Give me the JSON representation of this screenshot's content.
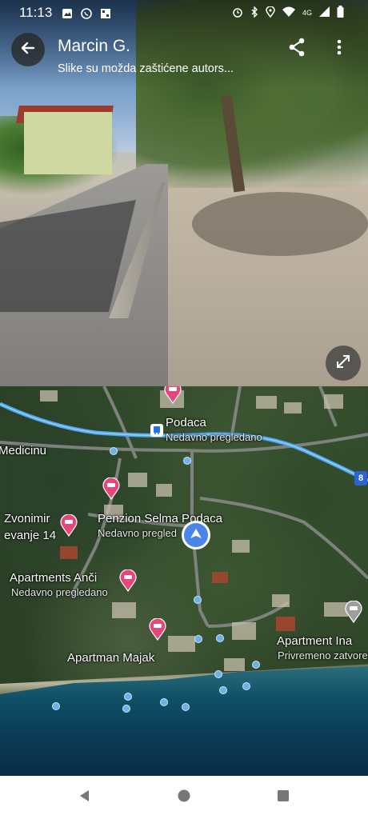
{
  "status_bar": {
    "time": "11:13",
    "network": "4G"
  },
  "header": {
    "title": "Marcin G.",
    "subtitle": "Slike su možda zaštićene autors..."
  },
  "map": {
    "labels": {
      "place_podaca": "Podaca",
      "place_podaca_sub": "Nedavno pregledano",
      "medicinu": "Medicinu",
      "zvonimir": "Zvonimir",
      "zvonimir_sub": "evanje 14",
      "penzion": "Penzion Selma Podaca",
      "penzion_sub": "Nedavno pregled",
      "anci": "Apartments Anči",
      "anci_sub": "Nedavno pregledano",
      "majak": "Apartman Majak",
      "ina": "Apartment Ina",
      "ina_sub": "Privremeno zatvoreno"
    },
    "route_badge": "8",
    "colors": {
      "route": "#4fa8f0",
      "pin": "#e8467a",
      "location": "#4a86e8"
    }
  },
  "nav": {
    "back": "back-triangle",
    "home": "home-circle",
    "recents": "recents-square"
  }
}
